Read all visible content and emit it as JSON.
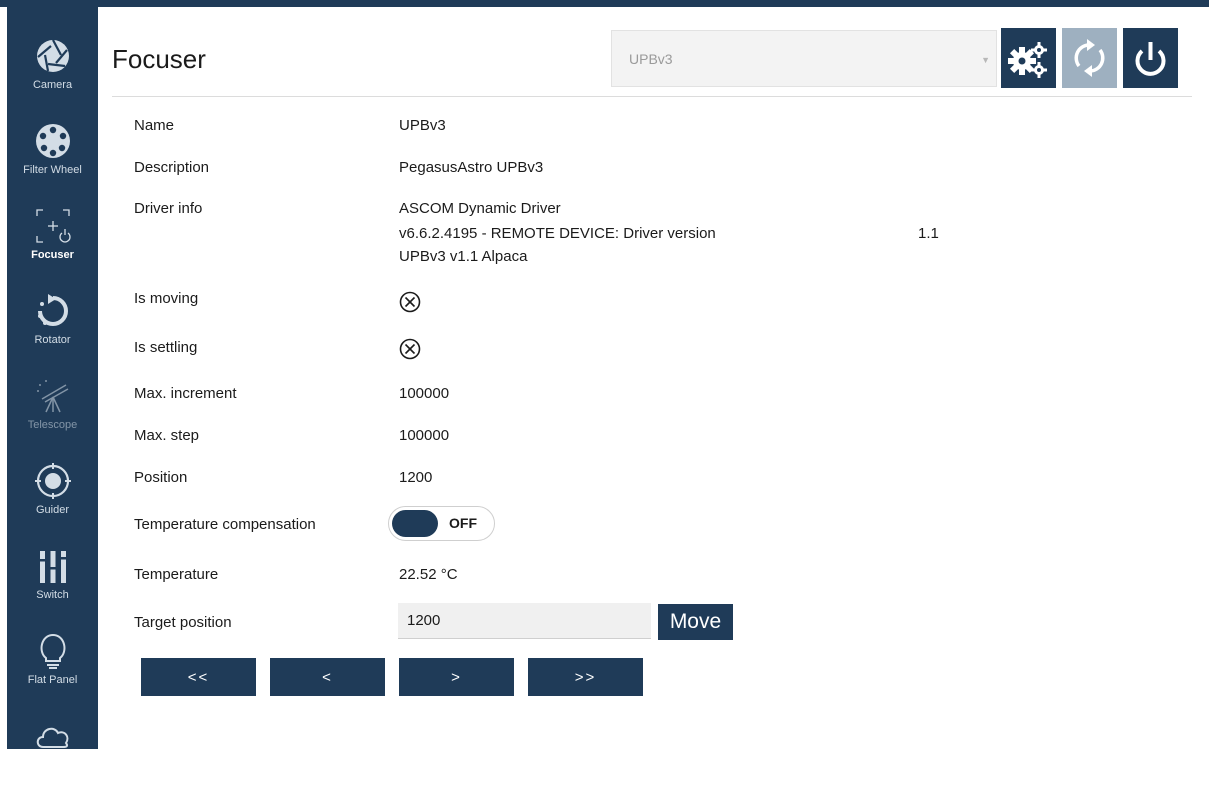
{
  "sidebar": {
    "items": [
      {
        "label": "Camera",
        "icon": "camera-aperture-icon"
      },
      {
        "label": "Filter Wheel",
        "icon": "filter-wheel-icon"
      },
      {
        "label": "Focuser",
        "icon": "focuser-icon",
        "active": true
      },
      {
        "label": "Rotator",
        "icon": "rotator-icon"
      },
      {
        "label": "Telescope",
        "icon": "telescope-icon"
      },
      {
        "label": "Guider",
        "icon": "guider-icon"
      },
      {
        "label": "Switch",
        "icon": "switch-icon"
      },
      {
        "label": "Flat Panel",
        "icon": "flat-panel-icon"
      },
      {
        "label": "",
        "icon": "weather-cloud-icon"
      }
    ]
  },
  "header": {
    "title": "Focuser",
    "device_selected": "UPBv3"
  },
  "toolbar": {
    "setup_icon": "gears-icon",
    "refresh_icon": "refresh-icon",
    "connect_icon": "power-icon"
  },
  "details": {
    "name_label": "Name",
    "name_value": "UPBv3",
    "description_label": "Description",
    "description_value": "PegasusAstro UPBv3",
    "driver_info_label": "Driver info",
    "driver_info_line1": "ASCOM Dynamic Driver",
    "driver_info_line2": "v6.6.2.4195 - REMOTE DEVICE:  Driver version",
    "driver_info_line3": "UPBv3 v1.1 Alpaca",
    "driver_version_value": "1.1",
    "is_moving_label": "Is moving",
    "is_settling_label": "Is settling",
    "max_increment_label": "Max. increment",
    "max_increment_value": "100000",
    "max_step_label": "Max. step",
    "max_step_value": "100000",
    "position_label": "Position",
    "position_value": "1200",
    "temp_comp_label": "Temperature compensation",
    "temp_comp_state": "OFF",
    "temperature_label": "Temperature",
    "temperature_value": "22.52 °C",
    "target_position_label": "Target position",
    "target_position_value": "1200",
    "move_label": "Move"
  },
  "step_buttons": {
    "far_back": "<<",
    "back": "<",
    "forward": ">",
    "far_forward": ">>"
  },
  "colors": {
    "accent": "#1f3b58",
    "disabled_button": "#9eb0c0"
  }
}
